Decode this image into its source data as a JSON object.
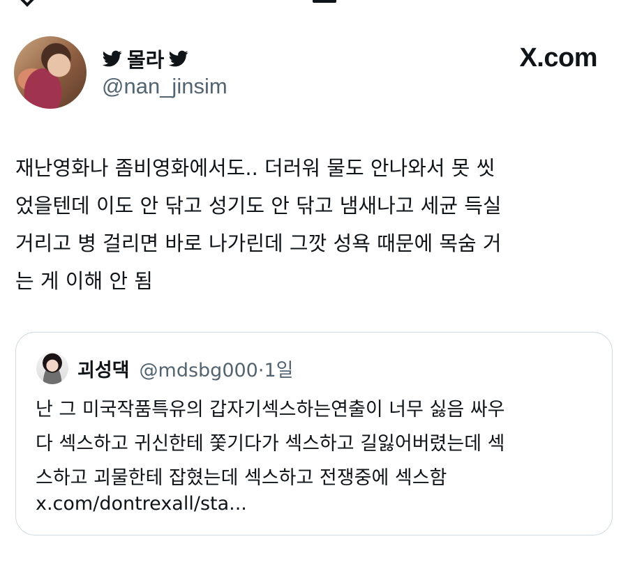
{
  "author": {
    "display_name": "몰라",
    "handle": "@nan_jinsim",
    "avatar_icon": "profile-photo"
  },
  "brand": "X.com",
  "tweet": {
    "text": "재난영화나 좀비영화에서도.. 더러워 물도 안나와서 못 씻\n었을텐데 이도 안 닦고 성기도 안 닦고 냄새나고 세균 득실\n거리고 병 걸리면 바로 나가린데 그깟 성욕 때문에 목숨 거\n는 게 이해 안 됨"
  },
  "quote": {
    "display_name": "괴성댁",
    "handle": "@mdsbg000",
    "time": "·1일",
    "text": "난 그 미국작품특유의 갑자기섹스하는연출이 너무 싫음 싸우\n다 섹스하고 귀신한테 쫓기다가 섹스하고 길잃어버렸는데 섹\n스하고 괴물한테 잡혔는데 섹스하고 전쟁중에 섹스함",
    "link": "x.com/dontrexall/sta..."
  },
  "colors": {
    "text": "#0f1419",
    "secondary": "#536471",
    "border": "#cfd9de"
  }
}
